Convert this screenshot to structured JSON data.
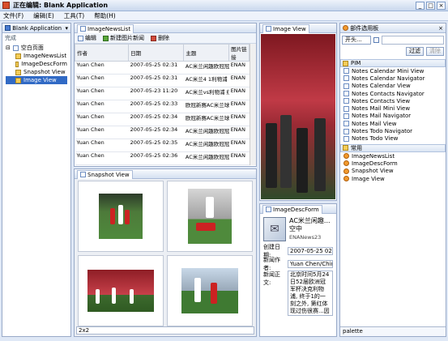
{
  "window": {
    "title": "正在编辑: Blank Application"
  },
  "menu": [
    "文件(F)",
    "编辑(E)",
    "工具(T)",
    "帮助(H)"
  ],
  "left_panel": {
    "title": "Blank Application",
    "status": "完成",
    "tree": [
      {
        "label": "空白页面",
        "level": 0
      },
      {
        "label": "ImageNewsList",
        "level": 1
      },
      {
        "label": "ImageDescForm",
        "level": 1
      },
      {
        "label": "Snapshot View",
        "level": 1
      },
      {
        "label": "Image View",
        "level": 1,
        "selected": true
      }
    ]
  },
  "news_list": {
    "tab": "ImageNewsList",
    "toolbar": {
      "edit": "编辑",
      "new": "新建图片新闻",
      "delete": "删除"
    },
    "columns": [
      "作者",
      "日期",
      "主题",
      "图片链接"
    ],
    "rows": [
      [
        "Yuan Chen",
        "2007-05-25 02:31",
        "AC米兰闲趣欧冠冠军杯",
        "ENAN"
      ],
      [
        "Yuan Chen",
        "2007-05-25 02:31",
        "AC米兰4 1利物浦 罗纳",
        "ENAN"
      ],
      [
        "Yuan Chen",
        "2007-05-23 11:20",
        "AC米兰vs利物浦 红军",
        "ENAN"
      ],
      [
        "Yuan Chen",
        "2007-05-25 02:33",
        "欧冠新赛AC米兰球队",
        "ENAN"
      ],
      [
        "Yuan Chen",
        "2007-05-25 02:34",
        "欧冠新赛AC米兰球员",
        "ENAN"
      ],
      [
        "Yuan Chen",
        "2007-05-25 02:34",
        "AC米兰闲趣欧冠冠军杯",
        "ENAN"
      ],
      [
        "Yuan Chen",
        "2007-05-25 02:35",
        "AC米兰闲趣欧冠冠军杯",
        "ENAN"
      ],
      [
        "Yuan Chen",
        "2007-05-25 02:36",
        "AC米兰闲趣欧冠冠军杯",
        "ENAN"
      ]
    ]
  },
  "snapshot": {
    "tab": "Snapshot View",
    "layout": "2x2"
  },
  "image_view": {
    "tab": "Image View"
  },
  "desc_form": {
    "tab": "ImageDescForm",
    "headline": "AC米兰闲趣...空中",
    "source": "ENANews23",
    "fields": [
      {
        "label": "创建日期:",
        "value": "2007-05-25 02:3"
      },
      {
        "label": "新闻作者:",
        "value": "Yuan Chen/Chinu"
      },
      {
        "label": "新闻正文:",
        "value": "北京时间5月24日52届欧洲冠军杯决克利物浦, 终于1的一刻之外, 第红体现过伤很赛...因罚钢组, 卡卡巧吃"
      }
    ]
  },
  "palette": {
    "title": "部件选用板",
    "filter_select": "开头...",
    "filter_btn": "过滤",
    "clear_btn": "清除",
    "sections": [
      {
        "name": "PIM",
        "items": [
          "Notes Calendar Mini View",
          "Notes Calendar Navigator",
          "Notes Calendar View",
          "Notes Contacts Navigator",
          "Notes Contacts View",
          "Notes Mail Mini View",
          "Notes Mail Navigator",
          "Notes Mail View",
          "Notes Todo Navigator",
          "Notes Todo View"
        ]
      },
      {
        "name": "常用",
        "items": [
          "ImageNewsList",
          "ImageDescForm",
          "Snapshot View",
          "Image View"
        ]
      }
    ],
    "footer": "palette"
  }
}
